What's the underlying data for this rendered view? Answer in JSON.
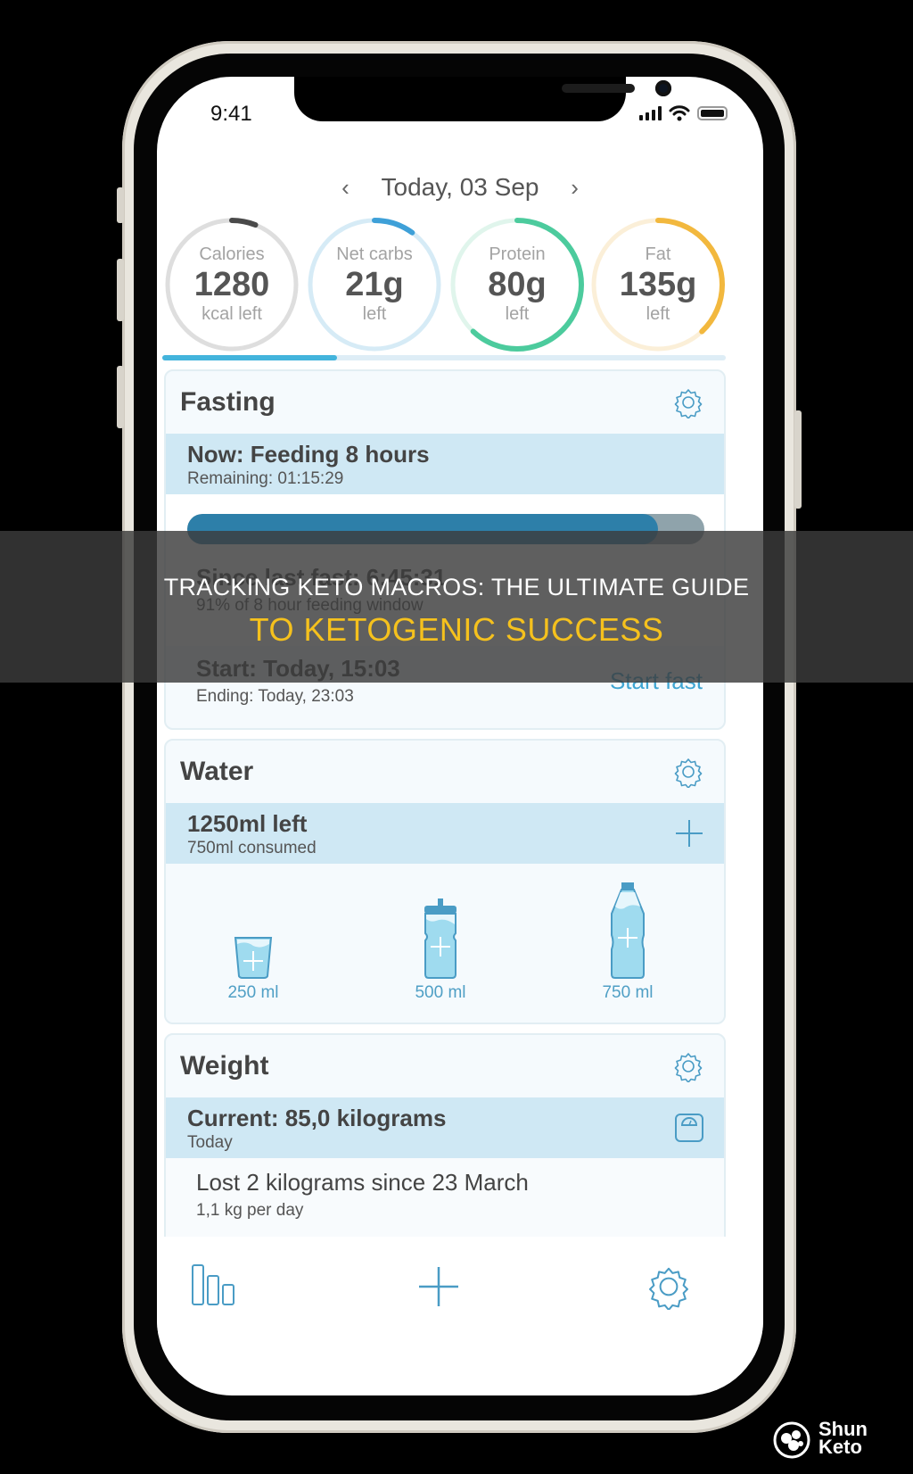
{
  "status_bar": {
    "time": "9:41",
    "icons": [
      "signal-icon",
      "wifi-icon",
      "battery-icon"
    ]
  },
  "date_nav": {
    "prev_icon": "‹",
    "label": "Today, 03 Sep",
    "next_icon": "›"
  },
  "macros": [
    {
      "label": "Calories",
      "value": "1280",
      "sub": "kcal left",
      "progress": 0.06,
      "start": 0.0,
      "color": "#4a4a4a",
      "track": "#dedede"
    },
    {
      "label": "Net carbs",
      "value": "21g",
      "sub": "left",
      "progress": 0.1,
      "start": 0.0,
      "color": "#3ea0d8",
      "track": "#d6ebf6"
    },
    {
      "label": "Protein",
      "value": "80g",
      "sub": "left",
      "progress": 0.62,
      "start": 0.0,
      "color": "#4ccb9d",
      "track": "#e0f5ec"
    },
    {
      "label": "Fat",
      "value": "135g",
      "sub": "left",
      "progress": 0.38,
      "start": 0.0,
      "color": "#f2b83e",
      "track": "#fbefd8"
    }
  ],
  "macro_pager": {
    "progress": 0.31
  },
  "fasting": {
    "title": "Fasting",
    "now_label": "Now: Feeding 8 hours",
    "remaining": "Remaining: 01:15:29",
    "progress": 0.91,
    "since_label": "Since last fast: 6:45:31",
    "window_label": "91% of 8 hour feeding window",
    "start_label": "Start: Today, 15:03",
    "ending_label": "Ending: Today, 23:03",
    "action": "Start fast"
  },
  "water": {
    "title": "Water",
    "left_label": "1250ml left",
    "consumed_label": "750ml consumed",
    "options": [
      {
        "label": "250 ml",
        "icon": "glass-icon"
      },
      {
        "label": "500 ml",
        "icon": "sport-bottle-icon"
      },
      {
        "label": "750 ml",
        "icon": "water-bottle-icon"
      }
    ]
  },
  "weight": {
    "title": "Weight",
    "current_label": "Current: 85,0 kilograms",
    "current_date": "Today",
    "lost_label": "Lost 2 kilograms since 23 March",
    "rate_label": "1,1 kg per day"
  },
  "tabbar": {
    "items": [
      "stats-icon",
      "add-icon",
      "settings-icon"
    ]
  },
  "overlay": {
    "line1": "TRACKING KETO MACROS: THE ULTIMATE GUIDE",
    "line2": "TO KETOGENIC SUCCESS"
  },
  "watermark": {
    "line1": "Shun",
    "line2": "Keto"
  }
}
